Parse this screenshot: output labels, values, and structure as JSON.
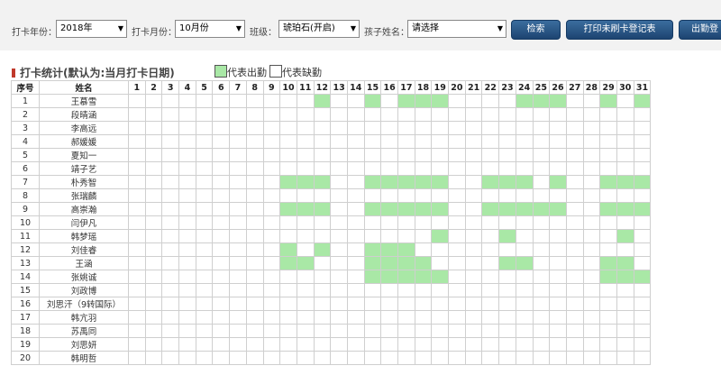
{
  "filters": {
    "year_label": "打卡年份：",
    "year_value": "2018年",
    "month_label": "打卡月份：",
    "month_value": "10月份",
    "class_label": "班级：",
    "class_value": "琥珀石(开启)",
    "child_label": "孩子姓名：",
    "child_value": "请选择"
  },
  "buttons": {
    "search": "检索",
    "print_unpunched": "打印未刷卡登记表",
    "export": "出勤登"
  },
  "section": {
    "title": "打卡统计(默认为:当月打卡日期)",
    "legend_present": "代表出勤",
    "legend_absent": "代表缺勤"
  },
  "colors": {
    "present": "#a9e8a6",
    "absent": "#ffffff",
    "button": "#1d4471",
    "title_marker": "#c0392b"
  },
  "table": {
    "col_index": "序号",
    "col_name": "姓名",
    "days": [
      "1",
      "2",
      "3",
      "4",
      "5",
      "6",
      "7",
      "8",
      "9",
      "10",
      "11",
      "12",
      "13",
      "14",
      "15",
      "16",
      "17",
      "18",
      "19",
      "20",
      "21",
      "22",
      "23",
      "24",
      "25",
      "26",
      "27",
      "28",
      "29",
      "30",
      "31"
    ],
    "rows": [
      {
        "index": "1",
        "name": "王慕雪",
        "present": [
          12,
          15,
          17,
          18,
          19,
          24,
          25,
          26,
          29,
          31
        ]
      },
      {
        "index": "2",
        "name": "段晴涵",
        "present": []
      },
      {
        "index": "3",
        "name": "李高远",
        "present": []
      },
      {
        "index": "4",
        "name": "郝媛媛",
        "present": []
      },
      {
        "index": "5",
        "name": "夏知一",
        "present": []
      },
      {
        "index": "6",
        "name": "靖子艺",
        "present": []
      },
      {
        "index": "7",
        "name": "朴秀智",
        "present": [
          10,
          11,
          12,
          15,
          16,
          17,
          18,
          19,
          22,
          23,
          24,
          26,
          29,
          30,
          31
        ]
      },
      {
        "index": "8",
        "name": "张瑞麟",
        "present": []
      },
      {
        "index": "9",
        "name": "高崇瀚",
        "present": [
          10,
          11,
          12,
          15,
          16,
          17,
          18,
          19,
          22,
          23,
          24,
          25,
          26,
          29,
          30,
          31
        ]
      },
      {
        "index": "10",
        "name": "闫伊凡",
        "present": []
      },
      {
        "index": "11",
        "name": "韩梦瑶",
        "present": [
          19,
          23,
          30
        ]
      },
      {
        "index": "12",
        "name": "刘佳睿",
        "present": [
          10,
          12,
          15,
          16,
          17
        ]
      },
      {
        "index": "13",
        "name": "王涵",
        "present": [
          10,
          11,
          15,
          16,
          17,
          18,
          23,
          24,
          29,
          30
        ]
      },
      {
        "index": "14",
        "name": "张姚诚",
        "present": [
          15,
          16,
          17,
          18,
          19,
          29,
          30,
          31
        ]
      },
      {
        "index": "15",
        "name": "刘政博",
        "present": []
      },
      {
        "index": "16",
        "name": "刘思汗（9转国际）",
        "present": []
      },
      {
        "index": "17",
        "name": "韩亢羽",
        "present": []
      },
      {
        "index": "18",
        "name": "苏禹同",
        "present": []
      },
      {
        "index": "19",
        "name": "刘思妍",
        "present": []
      },
      {
        "index": "20",
        "name": "韩明哲",
        "present": []
      }
    ]
  }
}
